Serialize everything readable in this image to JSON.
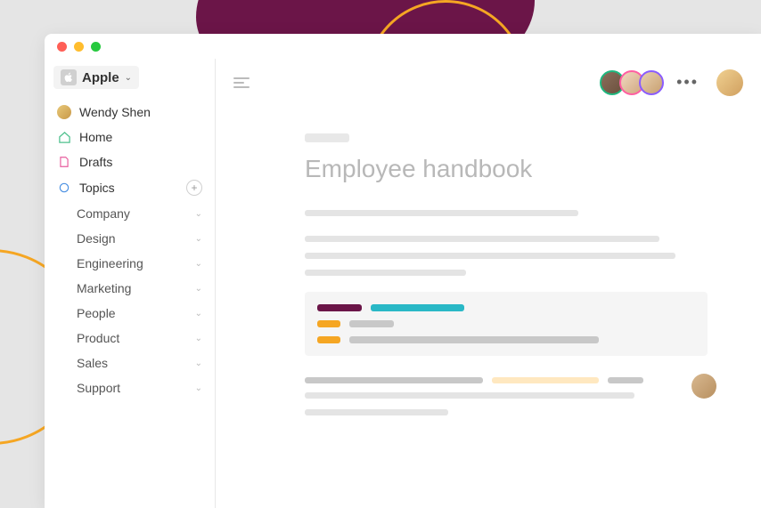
{
  "workspace": {
    "name": "Apple"
  },
  "user": {
    "name": "Wendy Shen"
  },
  "nav": {
    "home": "Home",
    "drafts": "Drafts",
    "topics": "Topics"
  },
  "topics": [
    {
      "label": "Company"
    },
    {
      "label": "Design"
    },
    {
      "label": "Engineering"
    },
    {
      "label": "Marketing"
    },
    {
      "label": "People"
    },
    {
      "label": "Product"
    },
    {
      "label": "Sales"
    },
    {
      "label": "Support"
    }
  ],
  "presence": {
    "ring_colors": [
      "#1fb87f",
      "#ff5fa2",
      "#8a5cff"
    ]
  },
  "document": {
    "title": "Employee handbook"
  },
  "colors": {
    "accent_purple": "#6b1548",
    "accent_teal": "#29b8c6",
    "accent_amber": "#f5a623"
  }
}
